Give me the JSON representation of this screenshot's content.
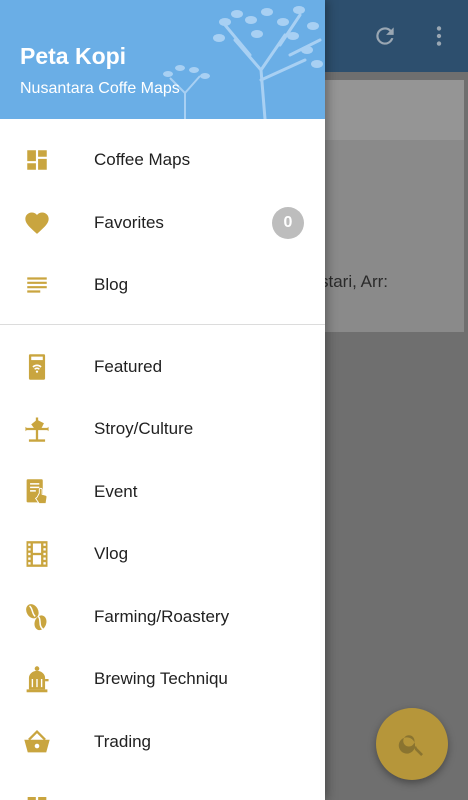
{
  "colors": {
    "accent": "#c9a53f",
    "header_bg": "#6aaee6",
    "appbar_bg": "#2d4f6e"
  },
  "drawer": {
    "title": "Peta Kopi",
    "subtitle": "Nusantara Coffe Maps",
    "primary_items": [
      {
        "label": "Coffee Maps",
        "icon": "dashboard-icon"
      },
      {
        "label": "Favorites",
        "icon": "heart-icon",
        "badge": "0"
      },
      {
        "label": "Blog",
        "icon": "lines-icon"
      }
    ],
    "category_items": [
      {
        "label": "Featured",
        "icon": "coffee-machine-icon"
      },
      {
        "label": "Stroy/Culture",
        "icon": "weathervane-icon"
      },
      {
        "label": "Event",
        "icon": "touch-list-icon"
      },
      {
        "label": "Vlog",
        "icon": "film-icon"
      },
      {
        "label": "Farming/Roastery",
        "icon": "coffee-beans-icon"
      },
      {
        "label": "Brewing Techniqu",
        "icon": "roaster-icon"
      },
      {
        "label": "Trading",
        "icon": "basket-icon"
      }
    ]
  },
  "background": {
    "card_text": "stari, Arr:"
  }
}
